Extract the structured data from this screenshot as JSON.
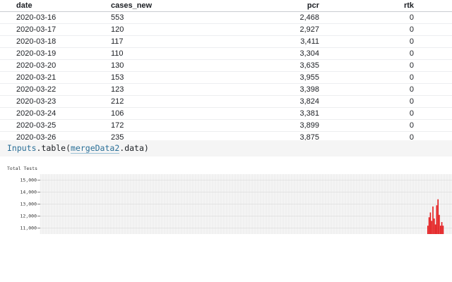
{
  "table": {
    "columns": [
      "date",
      "cases_new",
      "pcr",
      "rtk"
    ],
    "rows": [
      [
        "2020-03-16",
        "553",
        "2,468",
        "0"
      ],
      [
        "2020-03-17",
        "120",
        "2,927",
        "0"
      ],
      [
        "2020-03-18",
        "117",
        "3,411",
        "0"
      ],
      [
        "2020-03-19",
        "110",
        "3,304",
        "0"
      ],
      [
        "2020-03-20",
        "130",
        "3,635",
        "0"
      ],
      [
        "2020-03-21",
        "153",
        "3,955",
        "0"
      ],
      [
        "2020-03-22",
        "123",
        "3,398",
        "0"
      ],
      [
        "2020-03-23",
        "212",
        "3,824",
        "0"
      ],
      [
        "2020-03-24",
        "106",
        "3,381",
        "0"
      ],
      [
        "2020-03-25",
        "172",
        "3,899",
        "0"
      ],
      [
        "2020-03-26",
        "235",
        "3,875",
        "0"
      ]
    ]
  },
  "code": {
    "object": "Inputs",
    "method": ".table(",
    "ref": "mergeData2",
    "tail": ".data)"
  },
  "chart_data": {
    "type": "bar",
    "title": "Total Tests",
    "ylim": [
      10500,
      15500
    ],
    "yticks": [
      11000,
      12000,
      13000,
      14000,
      15000
    ],
    "ytick_labels": [
      "11,000",
      "12,000",
      "13,000",
      "14,000",
      "15,000"
    ],
    "grid": true,
    "bar_color": "#e41a1c",
    "values": [
      11200,
      11900,
      12300,
      11600,
      12800,
      11800,
      11300,
      12900,
      13400,
      12100,
      11200,
      11500,
      11200
    ]
  }
}
